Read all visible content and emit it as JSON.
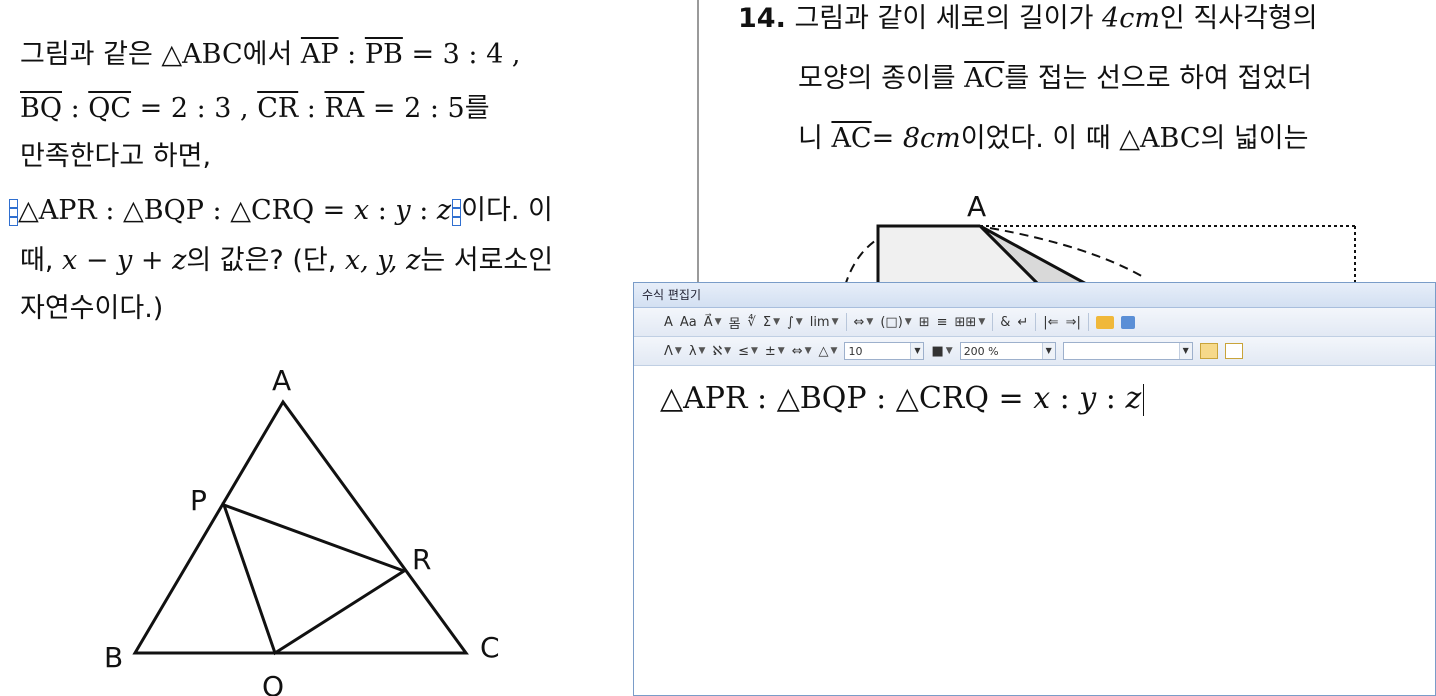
{
  "problem_left": {
    "l1_text": "그림과 같은 ",
    "l1_tri": "△ABC",
    "l1_ese": "에서 ",
    "seg_ap": "AP",
    "seg_pb": "PB",
    "ratio1": " : ",
    "ratio1_eq": " = 3 : 4 ,",
    "seg_bq": "BQ",
    "seg_qc": "QC",
    "ratio2_eq": " = 2 : 3 ,  ",
    "seg_cr": "CR",
    "seg_ra": "RA",
    "ratio3_eq": " = 2 : 5",
    "l2_tail": "를",
    "l3": "만족한다고 하면,",
    "l4_math": "△APR : △BQP : △CRQ = ",
    "l4_x": "x",
    "l4_y": "y",
    "l4_z": "z",
    "colon": " : ",
    "l4_tail": "이다. 이",
    "l5_head": "때, ",
    "l5_expr": "x − y + z",
    "l5_tail": "의 값은? (단, ",
    "l5_vars": "x, y, z",
    "l5_end": "는 서로소인",
    "l6": "자연수이다.)",
    "labels": {
      "A": "A",
      "P": "P",
      "R": "R",
      "B": "B",
      "C": "C",
      "Q": "Q"
    }
  },
  "problem_right": {
    "number": "14.",
    "r1_text": "그림과 같이 세로의 길이가 ",
    "r1_val": "4cm",
    "r1_tail": "인 직사각형의",
    "r2_text": "모양의 종이를 ",
    "r2_seg": "AC",
    "r2_tail": "를 접는 선으로 하여 접었더",
    "r3_head": "니 ",
    "r3_seg": "AC",
    "r3_val": "= 8cm",
    "r3_mid": "이었다. 이 때 ",
    "r3_tri": "△ABC",
    "r3_tail": "의 넓이는",
    "fig_label_A": "A"
  },
  "editor": {
    "title": "수식 편집기",
    "toolbar1": [
      "A",
      "Aa",
      "A⃗",
      "몸",
      "∜",
      "Σ",
      "∫",
      "lim",
      "⇔",
      "(□)",
      "⊞",
      "≡",
      "⊞⊞",
      "&",
      "↵",
      "|⇐",
      "⇒|"
    ],
    "toolbar2": [
      "Λ",
      "λ",
      "ℵ",
      "≤",
      "±",
      "⇔",
      "△"
    ],
    "font_size": "10",
    "zoom": "200 %",
    "equation": "△APR : △BQP : △CRQ = ",
    "eq_x": "x",
    "eq_y": "y",
    "eq_z": "z",
    "eq_colon": " : "
  }
}
